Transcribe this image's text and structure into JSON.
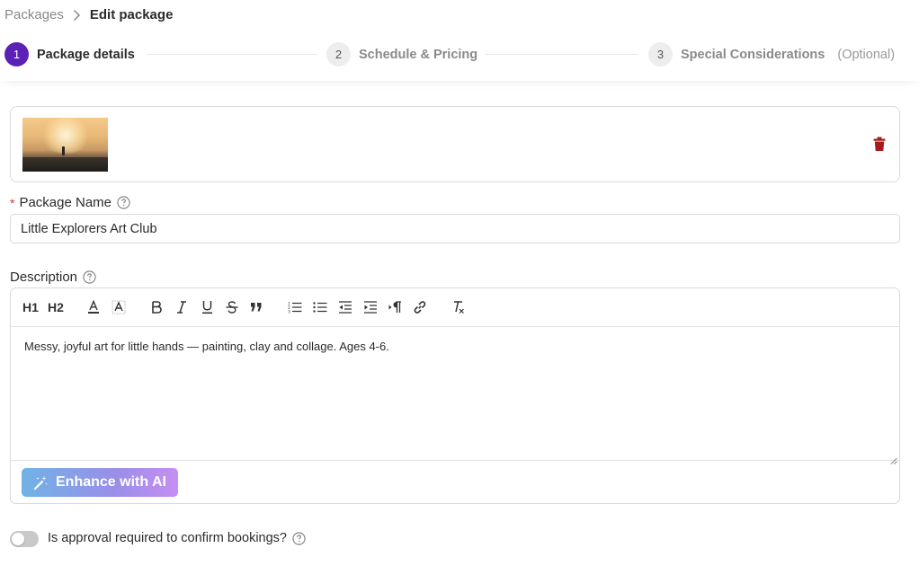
{
  "breadcrumb": {
    "parent": "Packages",
    "current": "Edit package"
  },
  "steps": [
    {
      "number": "1",
      "label": "Package details",
      "state": "active"
    },
    {
      "number": "2",
      "label": "Schedule & Pricing",
      "state": "inactive"
    },
    {
      "number": "3",
      "label": "Special Considerations",
      "optional": "(Optional)",
      "state": "inactive"
    }
  ],
  "colors": {
    "accent": "#5b21b6",
    "delete": "#a61b1b",
    "toggle_off": "#c9c9c9"
  },
  "image_card": {
    "delete_icon": "trash-icon"
  },
  "package_name": {
    "required_mark": "*",
    "label": "Package Name",
    "value": "Little Explorers Art Club"
  },
  "description": {
    "label": "Description",
    "text": "Messy, joyful art for little hands — painting, clay and collage. Ages 4-6."
  },
  "toolbar": {
    "h1": "H1",
    "h2": "H2",
    "icons": [
      "font-color-icon",
      "highlight-icon",
      "bold-icon",
      "italic-icon",
      "underline-icon",
      "strikethrough-icon",
      "quote-icon",
      "ordered-list-icon",
      "bullet-list-icon",
      "outdent-icon",
      "indent-icon",
      "text-direction-icon",
      "link-icon",
      "clear-format-icon"
    ]
  },
  "ai_button": {
    "label": "Enhance with AI"
  },
  "approval": {
    "label": "Is approval required to confirm bookings?",
    "enabled": false
  }
}
